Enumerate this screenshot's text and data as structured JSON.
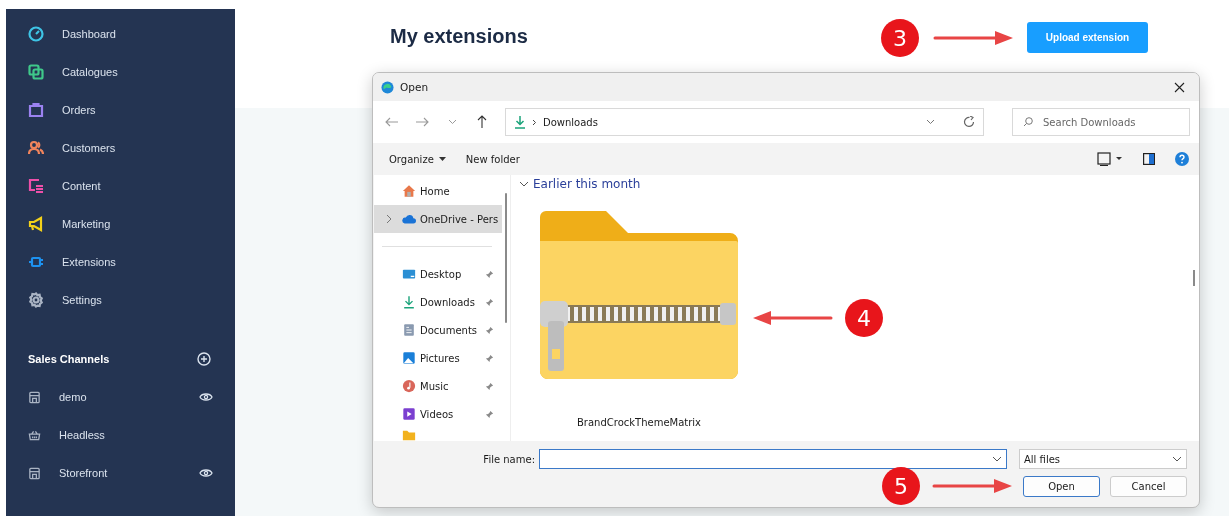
{
  "sidebar": {
    "items": [
      {
        "label": "Dashboard",
        "color": "#3ec4e6"
      },
      {
        "label": "Catalogues",
        "color": "#3fc88a"
      },
      {
        "label": "Orders",
        "color": "#9b82f0"
      },
      {
        "label": "Customers",
        "color": "#f0845c"
      },
      {
        "label": "Content",
        "color": "#ee4fa9"
      },
      {
        "label": "Marketing",
        "color": "#f3d11a"
      },
      {
        "label": "Extensions",
        "color": "#1d92f0"
      },
      {
        "label": "Settings",
        "color": "#aab4c4"
      }
    ],
    "sales_channels": {
      "title": "Sales Channels",
      "items": [
        {
          "label": "demo",
          "kind": "storefront",
          "preview": true
        },
        {
          "label": "Headless",
          "kind": "headless",
          "preview": false
        },
        {
          "label": "Storefront",
          "kind": "storefront",
          "preview": true
        }
      ]
    }
  },
  "page": {
    "title": "My extensions",
    "upload_button": "Upload extension"
  },
  "dialog": {
    "title": "Open",
    "path": "Downloads",
    "search_placeholder": "Search Downloads",
    "organize": "Organize",
    "new_folder": "New folder",
    "nav_locations": [
      {
        "label": "Home",
        "kind": "home",
        "selected": false,
        "expandable": false
      },
      {
        "label": "OneDrive - Pers",
        "kind": "cloud",
        "selected": true,
        "expandable": true
      }
    ],
    "nav_quick_access": [
      {
        "label": "Desktop",
        "kind": "desktop",
        "pinned": true
      },
      {
        "label": "Downloads",
        "kind": "download",
        "pinned": true
      },
      {
        "label": "Documents",
        "kind": "document",
        "pinned": true
      },
      {
        "label": "Pictures",
        "kind": "picture",
        "pinned": true
      },
      {
        "label": "Music",
        "kind": "music",
        "pinned": true
      },
      {
        "label": "Videos",
        "kind": "video",
        "pinned": true
      }
    ],
    "group": "Earlier this month",
    "files": [
      {
        "name": "BrandCrockThemeMatrix"
      }
    ],
    "file_name_label": "File name:",
    "filter": "All files",
    "open_button": "Open",
    "cancel_button": "Cancel"
  },
  "annotations": [
    {
      "number": "3"
    },
    {
      "number": "4"
    },
    {
      "number": "5"
    }
  ]
}
